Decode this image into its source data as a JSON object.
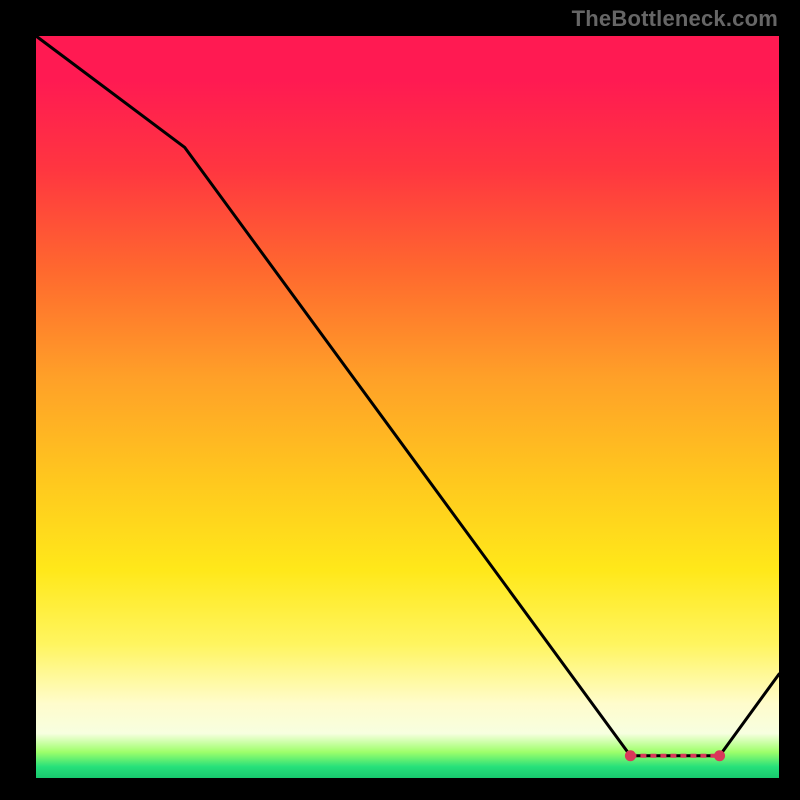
{
  "watermark": "TheBottleneck.com",
  "chart_data": {
    "type": "line",
    "title": "",
    "xlabel": "",
    "ylabel": "",
    "xlim": [
      0,
      100
    ],
    "ylim": [
      0,
      100
    ],
    "grid": false,
    "legend": false,
    "x": [
      0,
      20,
      80,
      92,
      100
    ],
    "values": [
      100,
      85,
      3,
      3,
      14
    ],
    "markers": {
      "shape": "circle",
      "color": "#d9385a",
      "x_range": [
        80,
        92
      ],
      "y": 3,
      "dashed_connector": true
    },
    "background_gradient": {
      "direction": "vertical",
      "stops": [
        {
          "pos": 0.0,
          "color": "#ff1a52"
        },
        {
          "pos": 0.32,
          "color": "#ff6a2e"
        },
        {
          "pos": 0.6,
          "color": "#ffc81e"
        },
        {
          "pos": 0.82,
          "color": "#fff560"
        },
        {
          "pos": 0.94,
          "color": "#f7ffe0"
        },
        {
          "pos": 0.985,
          "color": "#26e07a"
        },
        {
          "pos": 1.0,
          "color": "#18c96e"
        }
      ]
    }
  }
}
